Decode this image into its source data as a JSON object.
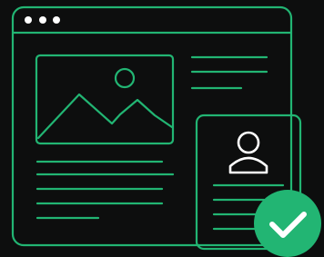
{
  "illustration": {
    "background_color": "#0d0e0e",
    "accent_color": "#22b573",
    "foreground_color": "#ffffff",
    "window_icon": "browser-window-icon",
    "image_icon": "landscape-image-icon",
    "profile_icon": "user-profile-card-icon",
    "badge_icon": "checkmark-icon",
    "badge_state": "verified",
    "window_control_dots": 3,
    "text_lines_beside_image": 3,
    "text_lines_below_image": 5,
    "text_lines_on_card": 4
  }
}
